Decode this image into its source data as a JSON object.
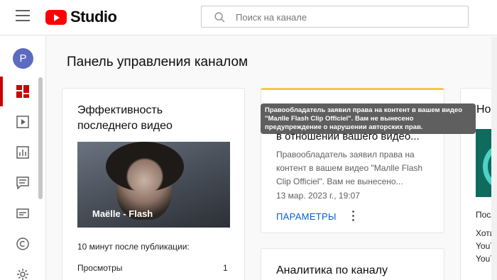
{
  "header": {
    "logo_text": "Studio",
    "search_placeholder": "Поиск на канале"
  },
  "sidebar": {
    "avatar_letter": "P",
    "items": [
      {
        "name": "dashboard",
        "icon": "dashboard-icon",
        "active": true
      },
      {
        "name": "content",
        "icon": "video-icon",
        "active": false
      },
      {
        "name": "analytics",
        "icon": "analytics-icon",
        "active": false
      },
      {
        "name": "comments",
        "icon": "comments-icon",
        "active": false
      },
      {
        "name": "subtitles",
        "icon": "subtitles-icon",
        "active": false
      },
      {
        "name": "copyright",
        "icon": "copyright-icon",
        "active": false
      },
      {
        "name": "settings",
        "icon": "gear-icon",
        "active": false
      }
    ]
  },
  "main": {
    "title": "Панель управления каналом",
    "card_performance": {
      "title_line1": "Эффективность",
      "title_line2": "последнего видео",
      "video_title": "Maëlle - Flash",
      "since_label": "10 минут после публикации:",
      "views_label": "Просмотры",
      "views_value": "1"
    },
    "card_copyright": {
      "heading": "в отношении вашего видео...",
      "body": "Правообладатель заявил права на контент в вашем видео \"Maлlle Flash Clip Officiel\". Вам не вынесено...",
      "date": "13 мар. 2023 г., 19:07",
      "action_label": "ПАРАМЕТРЫ",
      "tooltip": "Правообладатель заявил права на контент в вашем видео \"Maлlle Flash Clip Officiel\". Вам не вынесено предупреждение о нарушении авторских прав."
    },
    "card_analytics": {
      "title": "Аналитика по каналу"
    },
    "card_news": {
      "title": "Нов",
      "subtitle": "Посл",
      "line1": "Хотит",
      "line2": "YouTu",
      "line3": "YouTu"
    }
  },
  "colors": {
    "accent_red": "#ff0000",
    "active_nav": "#cc0000",
    "link_blue": "#065fd4",
    "warning_yellow": "#f2c94c",
    "avatar": "#5c6bc0"
  }
}
